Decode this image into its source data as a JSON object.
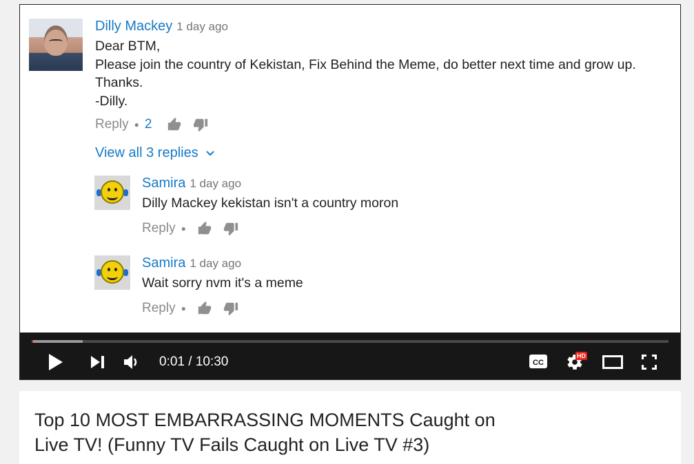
{
  "comments": [
    {
      "author": "Dilly Mackey",
      "time": "1 day ago",
      "lines": [
        "Dear BTM,",
        "Please join the country of Kekistan, Fix Behind the Meme, do better next time and grow up.",
        "Thanks.",
        "-Dilly."
      ],
      "reply_label": "Reply",
      "like_count": "2",
      "avatar_icon": "user-photo"
    }
  ],
  "view_replies": "View all 3 replies",
  "replies": [
    {
      "author": "Samira",
      "time": "1 day ago",
      "text": "Dilly Mackey kekistan isn't a country moron",
      "reply_label": "Reply",
      "avatar_icon": "smiley-face"
    },
    {
      "author": "Samira",
      "time": "1 day ago",
      "text": "Wait sorry nvm it's a meme",
      "reply_label": "Reply",
      "avatar_icon": "smiley-face"
    }
  ],
  "player": {
    "time_display": "0:01 / 10:30",
    "progress_fraction": 0.08,
    "hd_badge": "HD",
    "icons": [
      "play-icon",
      "next-icon",
      "volume-icon",
      "captions-icon",
      "settings-icon",
      "theater-icon",
      "fullscreen-icon"
    ]
  },
  "video": {
    "title": "Top 10 MOST EMBARRASSING MOMENTS Caught on Live TV! (Funny TV Fails Caught on Live TV #3)"
  },
  "colors": {
    "link": "#167ac6",
    "progress": "#e62117",
    "controls_bg": "#171717"
  }
}
